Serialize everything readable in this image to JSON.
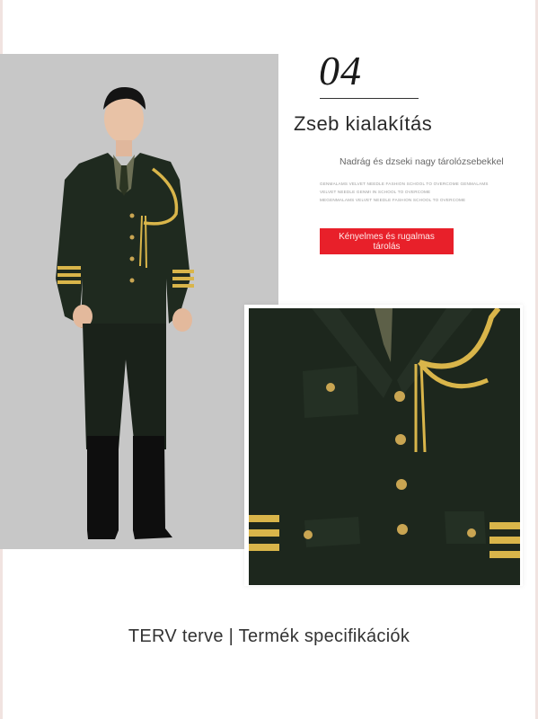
{
  "section": {
    "number": "04",
    "title": "Zseb kialakítás",
    "subtitle": "Nadrág és dzseki nagy tárolózsebekkel",
    "small_text": [
      "GENMALAMS VELVET NEEDLE FASHION SCHOOL TO OVERCOME GENMALAMS",
      "VELVET NEEDLE GENMI IN SCHOOL TO OVERCOME",
      "MEGENMALAMS VELVET NEEDLE FASHION SCHOOL TO OVERCOME"
    ],
    "badge": "Kényelmes és rugalmas tárolás"
  },
  "footer": {
    "text": "TERV terve | Termék specifikációk"
  },
  "images": {
    "full_body": "uniform-full-body-photo",
    "detail": "jacket-pocket-detail-photo"
  },
  "colors": {
    "accent_red": "#e8202a",
    "uniform_green": "#1f2a1f",
    "gold_trim": "#d9b54a"
  }
}
